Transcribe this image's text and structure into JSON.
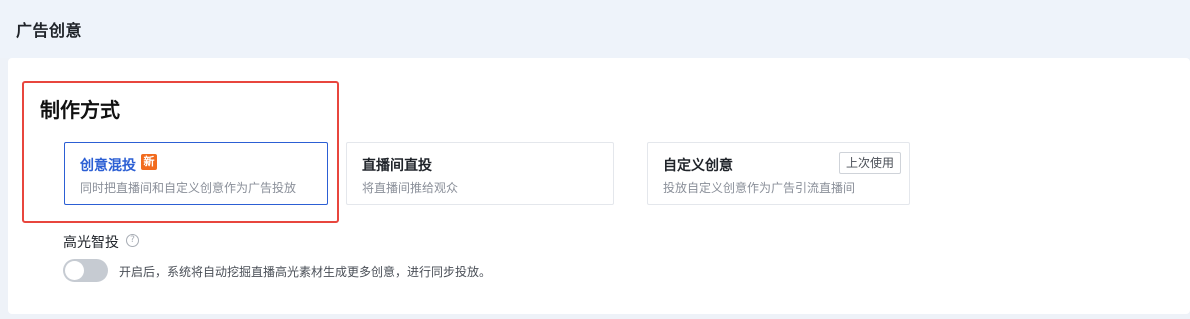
{
  "header": {
    "title": "广告创意"
  },
  "production": {
    "section_title": "制作方式",
    "cards": [
      {
        "title": "创意混投",
        "badge": "新",
        "description": "同时把直播间和自定义创意作为广告投放",
        "selected": true
      },
      {
        "title": "直播间直投",
        "description": "将直播间推给观众",
        "selected": false
      },
      {
        "title": "自定义创意",
        "tag": "上次使用",
        "description": "投放自定义创意作为广告引流直播间",
        "selected": false
      }
    ]
  },
  "smart_delivery": {
    "label": "高光智投",
    "help_icon": "?",
    "toggle_on": false,
    "description": "开启后，系统将自动挖掘直播高光素材生成更多创意，进行同步投放。"
  },
  "colors": {
    "accent": "#2c5fd4",
    "highlight_border": "#e8463e",
    "new_badge": "#f26b1d"
  }
}
